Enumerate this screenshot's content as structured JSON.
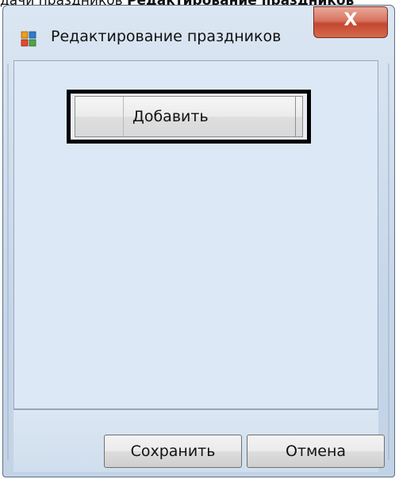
{
  "document": {
    "clipped_text_normal": "дачи праздников ",
    "clipped_text_bold": "Редактирование праздников"
  },
  "window": {
    "title": "Редактирование праздников",
    "close_label": "X",
    "icon": "app-window-icon"
  },
  "toolbar": {
    "add_label": "Добавить"
  },
  "footer": {
    "save_label": "Сохранить",
    "cancel_label": "Отмена"
  },
  "colors": {
    "window_bg": "#dce8f5",
    "close_button": "#c4472f",
    "highlight_border": "#000000"
  }
}
